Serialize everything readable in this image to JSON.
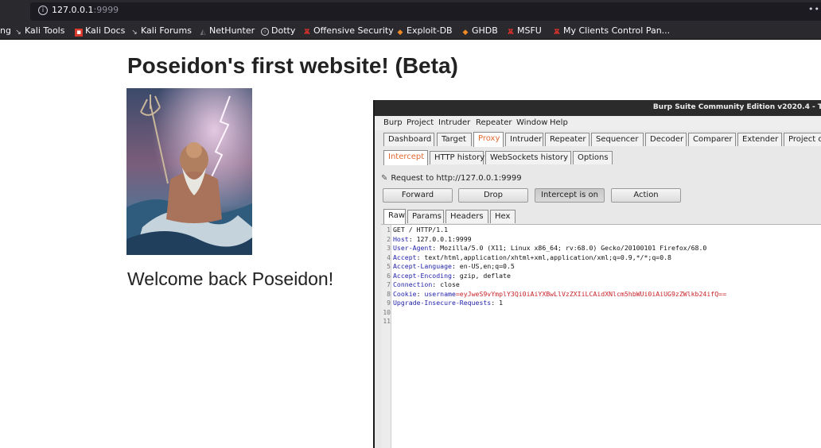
{
  "browser": {
    "url_host": "127.0.0.1",
    "url_port": ":9999",
    "more_icon": "ellipsis-icon",
    "bookmarks": [
      {
        "label": "ng",
        "icon": "none"
      },
      {
        "label": "Kali Tools",
        "icon": "kali-dragon-icon"
      },
      {
        "label": "Kali Docs",
        "icon": "kali-docs-icon"
      },
      {
        "label": "Kali Forums",
        "icon": "kali-dragon-icon"
      },
      {
        "label": "NetHunter",
        "icon": "nethunter-icon"
      },
      {
        "label": "Dotty",
        "icon": "dotty-icon"
      },
      {
        "label": "Offensive Security",
        "icon": "offsec-icon"
      },
      {
        "label": "Exploit-DB",
        "icon": "exploitdb-icon"
      },
      {
        "label": "GHDB",
        "icon": "exploitdb-icon"
      },
      {
        "label": "MSFU",
        "icon": "offsec-icon"
      },
      {
        "label": "My Clients Control Pan...",
        "icon": "offsec-icon"
      }
    ]
  },
  "page": {
    "title": "Poseidon's first website! (Beta)",
    "image": "poseidon-illustration",
    "welcome": "Welcome back Poseidon!"
  },
  "burp": {
    "window_title": "Burp Suite Community Edition v2020.4 - T",
    "menu": [
      "Burp",
      "Project",
      "Intruder",
      "Repeater",
      "Window",
      "Help"
    ],
    "main_tabs": [
      "Dashboard",
      "Target",
      "Proxy",
      "Intruder",
      "Repeater",
      "Sequencer",
      "Decoder",
      "Comparer",
      "Extender",
      "Project o"
    ],
    "active_main_tab": "Proxy",
    "sub_tabs": [
      "Intercept",
      "HTTP history",
      "WebSockets history",
      "Options"
    ],
    "active_sub_tab": "Intercept",
    "request_to": "Request to http://127.0.0.1:9999",
    "buttons": {
      "forward": "Forward",
      "drop": "Drop",
      "intercept": "Intercept is on",
      "action": "Action"
    },
    "view_tabs": [
      "Raw",
      "Params",
      "Headers",
      "Hex"
    ],
    "active_view_tab": "Raw",
    "accent_color": "#e06a31",
    "request_lines": [
      {
        "n": "1",
        "key": "",
        "value": "GET / HTTP/1.1"
      },
      {
        "n": "2",
        "key": "Host",
        "value": ": 127.0.0.1:9999"
      },
      {
        "n": "3",
        "key": "User-Agent",
        "value": ": Mozilla/5.0 (X11; Linux x86_64; rv:68.0) Gecko/20100101 Firefox/68.0"
      },
      {
        "n": "4",
        "key": "Accept",
        "value": ": text/html,application/xhtml+xml,application/xml;q=0.9,*/*;q=0.8"
      },
      {
        "n": "5",
        "key": "Accept-Language",
        "value": ": en-US,en;q=0.5"
      },
      {
        "n": "6",
        "key": "Accept-Encoding",
        "value": ": gzip, deflate"
      },
      {
        "n": "7",
        "key": "Connection",
        "value": ": close"
      },
      {
        "n": "8",
        "key": "Cookie",
        "value": ": ",
        "cookie_name": "username",
        "cookie_value": "=eyJweS9vYmplY3Qi0iAiYXBwLlVzZXIiLCAidXNlcm5hbWUi0iAiUG9zZWlkb24ifQ=="
      },
      {
        "n": "9",
        "key": "Upgrade-Insecure-Requests",
        "value": ": 1"
      },
      {
        "n": "10",
        "key": "",
        "value": ""
      },
      {
        "n": "11",
        "key": "",
        "value": ""
      }
    ]
  }
}
